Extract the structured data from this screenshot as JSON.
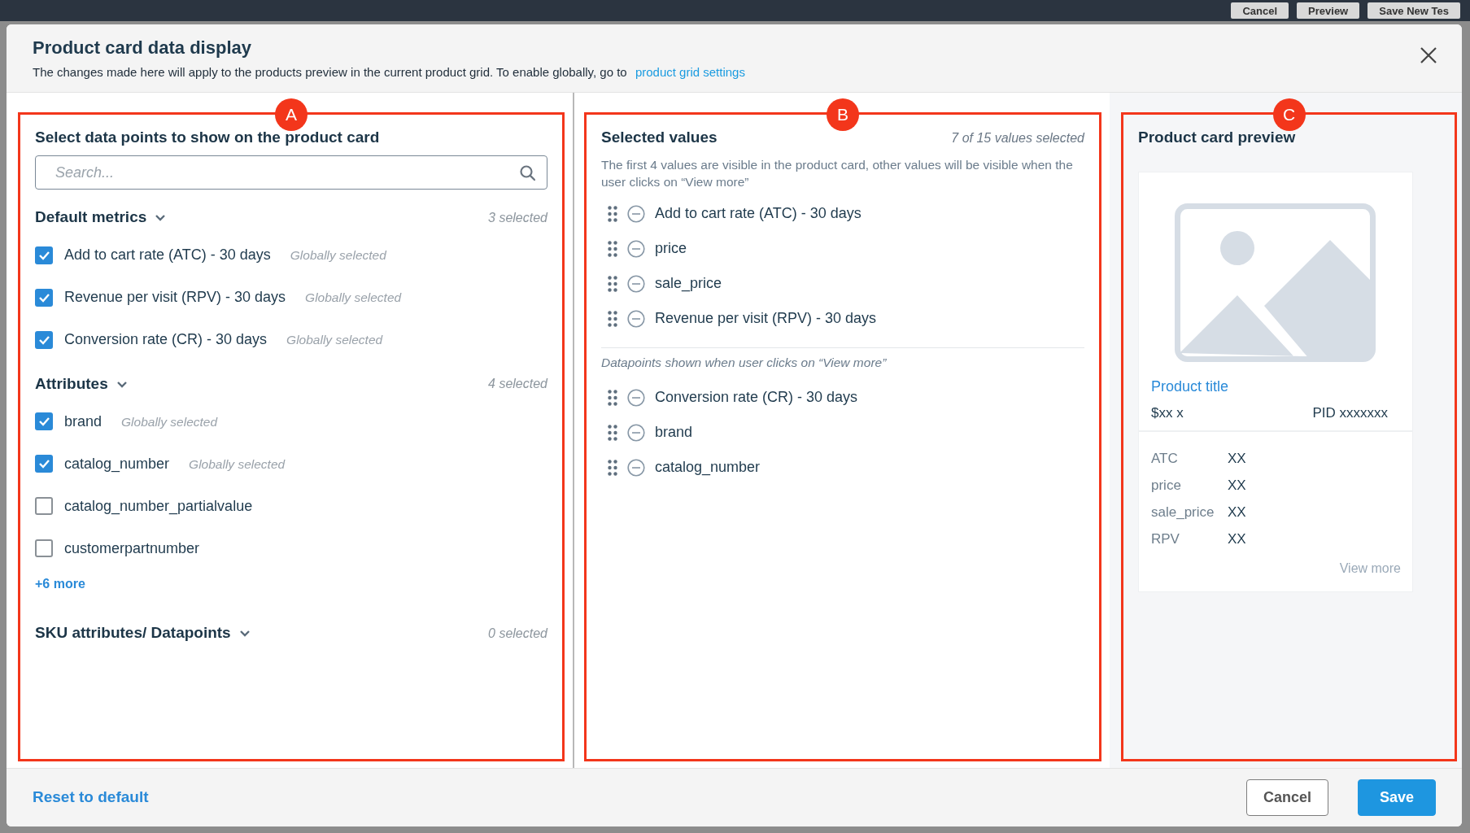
{
  "background": {
    "buttons": [
      "Cancel",
      "Preview",
      "Save New Tes"
    ]
  },
  "dialog": {
    "title": "Product card data display",
    "subtitle": "The changes made here will apply to the products preview in the current product grid. To enable globally, go to",
    "subtitle_link": "product grid settings"
  },
  "data_points": {
    "marker": "A",
    "heading": "Select data points to show on the product card",
    "search": {
      "placeholder": "Search..."
    },
    "groups": [
      {
        "title": "Default metrics",
        "count": "3 selected",
        "expanded": true,
        "items": [
          {
            "label": "Add to cart rate (ATC) - 30 days",
            "checked": true,
            "note": "Globally selected"
          },
          {
            "label": "Revenue per visit (RPV) - 30 days",
            "checked": true,
            "note": "Globally selected"
          },
          {
            "label": "Conversion rate (CR) - 30 days",
            "checked": true,
            "note": "Globally selected"
          }
        ]
      },
      {
        "title": "Attributes",
        "count": "4 selected",
        "expanded": true,
        "items": [
          {
            "label": "brand",
            "checked": true,
            "note": "Globally selected"
          },
          {
            "label": "catalog_number",
            "checked": true,
            "note": "Globally selected"
          },
          {
            "label": "catalog_number_partialvalue",
            "checked": false
          },
          {
            "label": "customerpartnumber",
            "checked": false
          }
        ],
        "more_link": "+6 more"
      },
      {
        "title": "SKU attributes/ Datapoints",
        "count": "0 selected",
        "expanded": true
      }
    ]
  },
  "selected_values": {
    "marker": "B",
    "heading": "Selected values",
    "count": "7 of 15 values selected",
    "description": "The first 4 values are visible in the product card, other values will be visible when the user clicks on “View more”",
    "visible": [
      "Add to cart rate (ATC) - 30 days",
      "price",
      "sale_price",
      "Revenue per visit (RPV) - 30 days"
    ],
    "more_caption": "Datapoints shown when user clicks on “View more”",
    "more": [
      "Conversion rate (CR) - 30 days",
      "brand",
      "catalog_number"
    ]
  },
  "preview": {
    "marker": "C",
    "heading": "Product card preview",
    "title": "Product title",
    "price": "$xx x",
    "pid": "PID xxxxxxx",
    "rows": [
      {
        "label": "ATC",
        "value": "XX"
      },
      {
        "label": "price",
        "value": "XX"
      },
      {
        "label": "sale_price",
        "value": "XX"
      },
      {
        "label": "RPV",
        "value": "XX"
      }
    ],
    "view_more": "View more"
  },
  "footer": {
    "reset": "Reset to default",
    "buttons": [
      {
        "label": "Cancel",
        "kind": "secondary"
      },
      {
        "label": "Save",
        "kind": "primary"
      }
    ]
  }
}
